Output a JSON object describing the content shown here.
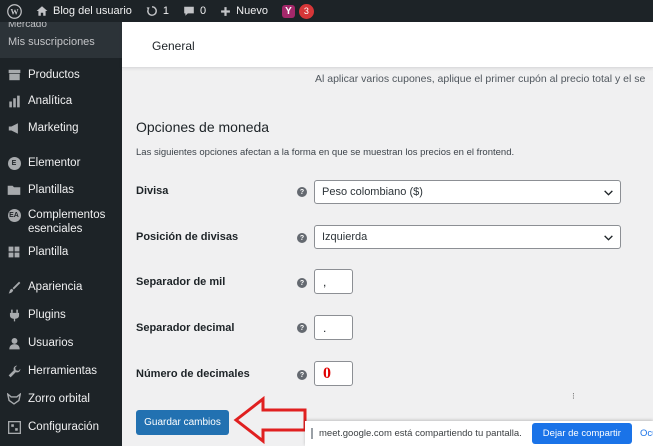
{
  "adminbar": {
    "site_name": "Blog del usuario",
    "updates_count": "1",
    "comments_count": "0",
    "new_label": "Nuevo",
    "yoast_badge": "3",
    "icons": [
      "wordpress-logo-icon",
      "home-icon",
      "updates-icon",
      "comment-icon",
      "plus-icon",
      "yoast-icon"
    ]
  },
  "sidebar": {
    "submenu_cut": "Mercado",
    "submenu_item": "Mis suscripciones",
    "items": [
      {
        "label": "Productos",
        "icon": "archive-icon"
      },
      {
        "label": "Analítica",
        "icon": "bar-chart-icon"
      },
      {
        "label": "Marketing",
        "icon": "megaphone-icon"
      },
      {
        "label": "Elementor",
        "icon": "elementor-icon"
      },
      {
        "label": "Plantillas",
        "icon": "folder-icon"
      },
      {
        "label": "Complementos esenciales",
        "icon": "ea-icon"
      },
      {
        "label": "Plantilla",
        "icon": "grid-icon"
      },
      {
        "label": "Apariencia",
        "icon": "paintbrush-icon"
      },
      {
        "label": "Plugins",
        "icon": "plug-icon"
      },
      {
        "label": "Usuarios",
        "icon": "user-icon"
      },
      {
        "label": "Herramientas",
        "icon": "wrench-icon"
      },
      {
        "label": "Zorro orbital",
        "icon": "fox-icon"
      },
      {
        "label": "Configuración",
        "icon": "settings-icon"
      }
    ]
  },
  "tabs": {
    "general": "General"
  },
  "coupon_note": "Al aplicar varios cupones, aplique el primer cupón al precio total y el se",
  "currency": {
    "title": "Opciones de moneda",
    "description": "Las siguientes opciones afectan a la forma en que se muestran los precios en el frontend.",
    "divisa_label": "Divisa",
    "divisa_value": "Peso colombiano ($)",
    "position_label": "Posición de divisas",
    "position_value": "Izquierda",
    "thousand_label": "Separador de mil",
    "thousand_value": ",",
    "decimal_label": "Separador decimal",
    "decimal_value": ".",
    "decimals_label": "Número de decimales",
    "decimals_value": "0",
    "help_glyph": "?"
  },
  "save_label": "Guardar cambios",
  "sharebar": {
    "message": "meet.google.com está compartiendo tu pantalla.",
    "stop_label": "Dejar de compartir",
    "hide_label": "Ocu"
  },
  "colors": {
    "admin_dark": "#1d2327",
    "primary_blue": "#2271b1",
    "arrow_red": "#e02020",
    "meet_blue": "#1a73e8"
  }
}
